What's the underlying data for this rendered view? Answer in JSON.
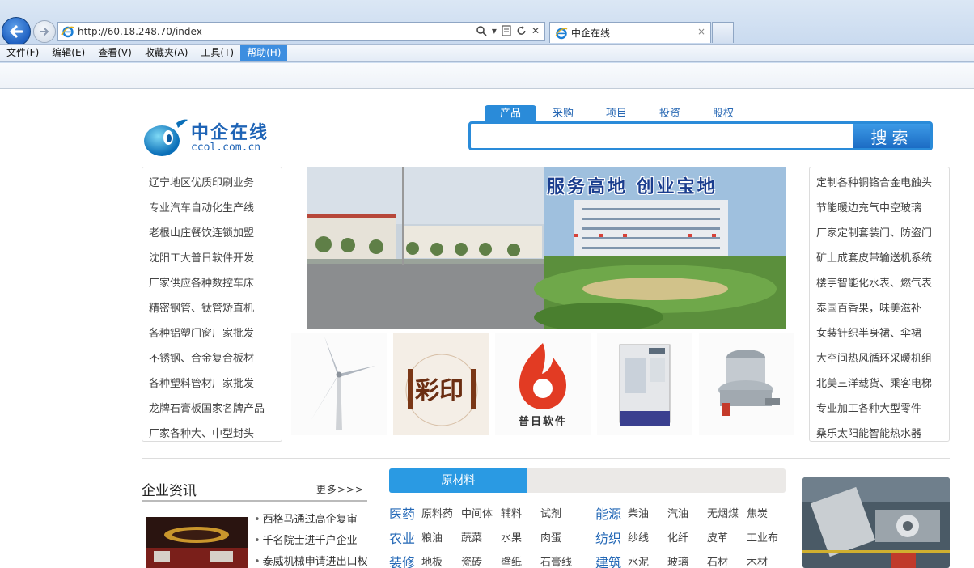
{
  "browser": {
    "url": "http://60.18.248.70/index",
    "tab_title": "中企在线",
    "tab_close": "×",
    "menu": [
      "文件(F)",
      "编辑(E)",
      "查看(V)",
      "收藏夹(A)",
      "工具(T)",
      "帮助(H)"
    ],
    "active_menu": "帮助(H)"
  },
  "logo": {
    "title": "中企在线",
    "domain": "ccol.com.cn"
  },
  "search": {
    "tabs": [
      "产品",
      "采购",
      "项目",
      "投资",
      "股权"
    ],
    "active_tab": "产品",
    "button": "搜索",
    "placeholder": ""
  },
  "left_list": [
    "辽宁地区优质印刷业务",
    "专业汽车自动化生产线",
    "老根山庄餐饮连锁加盟",
    "沈阳工大普日软件开发",
    "厂家供应各种数控车床",
    "精密钢管、钛管矫直机",
    "各种铝塑门窗厂家批发",
    "不锈钢、合金复合板材",
    "各种塑料管材厂家批发",
    "龙牌石膏板国家名牌产品",
    "厂家各种大、中型封头"
  ],
  "right_list": [
    "定制各种铜铬合金电触头",
    "节能暖边充气中空玻璃",
    "厂家定制套装门、防盗门",
    "矿上成套皮带输送机系统",
    "楼宇智能化水表、燃气表",
    "泰国百香果，味美滋补",
    "女装针织半身裙、伞裙",
    "大空间热风循环采暖机组",
    "北美三洋载货、乘客电梯",
    "专业加工各种大型零件",
    "桑乐太阳能智能热水器"
  ],
  "banner": {
    "slogan": "服务高地  创业宝地"
  },
  "thumbs": [
    {
      "name": "wind-turbine",
      "label": ""
    },
    {
      "name": "color-print",
      "label": "彩印"
    },
    {
      "name": "puri-software",
      "label": "普日软件"
    },
    {
      "name": "cnc-machine",
      "label": ""
    },
    {
      "name": "crusher",
      "label": ""
    }
  ],
  "news": {
    "title": "企业资讯",
    "more": "更多>>>",
    "items": [
      "西格马通过高企复审",
      "千名院士进千户企业",
      "泰威机械申请进出口权"
    ]
  },
  "categories": {
    "tab": "原材料",
    "rows": [
      [
        {
          "name": "医药",
          "subs": [
            "原料药",
            "中间体",
            "辅料",
            "试剂"
          ]
        },
        {
          "name": "能源",
          "subs": [
            "柴油",
            "汽油",
            "无烟煤",
            "焦炭"
          ]
        }
      ],
      [
        {
          "name": "农业",
          "subs": [
            "粮油",
            "蔬菜",
            "水果",
            "肉蛋"
          ]
        },
        {
          "name": "纺织",
          "subs": [
            "纱线",
            "化纤",
            "皮革",
            "工业布"
          ]
        }
      ],
      [
        {
          "name": "装修",
          "subs": [
            "地板",
            "瓷砖",
            "壁纸",
            "石膏线"
          ]
        },
        {
          "name": "建筑",
          "subs": [
            "水泥",
            "玻璃",
            "石材",
            "木材"
          ]
        }
      ]
    ]
  },
  "colors": {
    "accent": "#2a8bd9",
    "brand": "#1f64b6",
    "menu_active": "#3d8ee0"
  }
}
